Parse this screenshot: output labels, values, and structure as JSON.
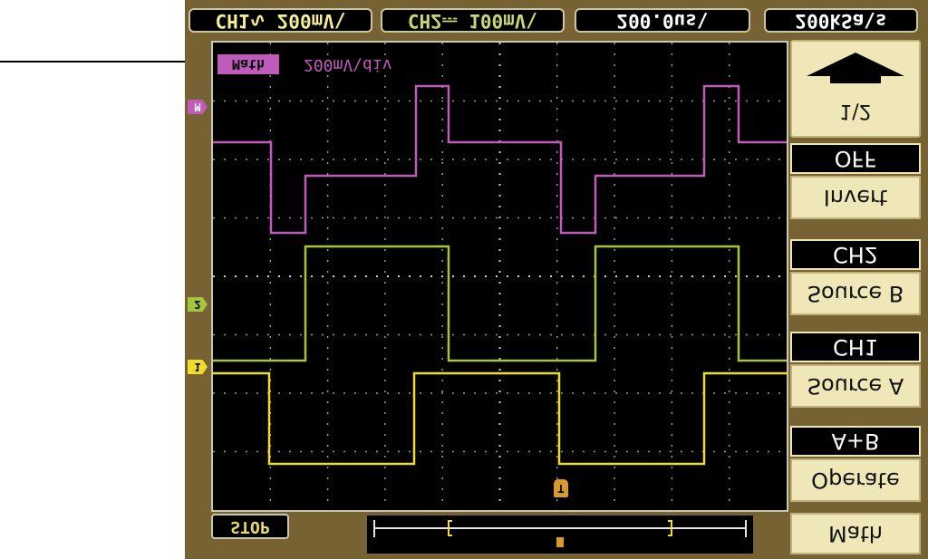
{
  "header": {
    "ch1_label": "CH1∿  200mV\\",
    "ch2_label": "CH2⎓  100mV\\",
    "timebase_label": "200.0us\\",
    "sample_rate_label": "200kSa\\s"
  },
  "screen": {
    "math_tag": "Math",
    "math_scale": "200mV\\div",
    "markers": {
      "math": "M",
      "ch2": "2",
      "ch1": "1",
      "trigger": "T"
    }
  },
  "status": {
    "run_state": "STOP"
  },
  "menu": {
    "scroll_up": "1\\2",
    "invert_value": "OFF",
    "invert_label": "Invert",
    "source_b_value": "CH2",
    "source_b_label": "Source B",
    "source_a_value": "CH1",
    "source_a_label": "Source A",
    "operate_value": "A+B",
    "operate_label": "Operate",
    "title": "Math"
  },
  "colors": {
    "math_trace": "#c15bbb",
    "ch2_trace": "#a6c53e",
    "ch1_trace": "#eede2a",
    "trigger": "#d99a2c",
    "frame": "#766232",
    "menu_bg": "#efe7b7"
  }
}
